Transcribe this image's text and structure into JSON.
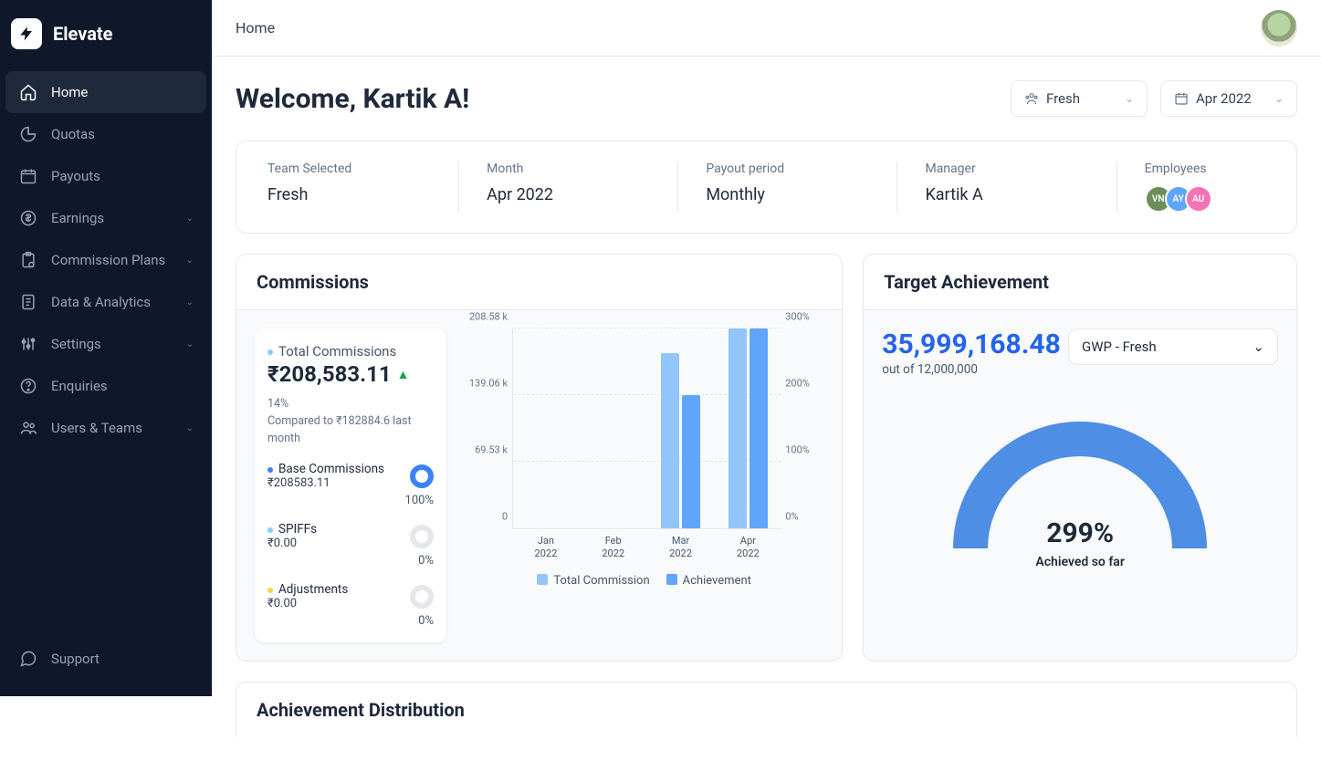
{
  "brand": "Elevate",
  "breadcrumb": "Home",
  "sidebar": {
    "items": [
      {
        "label": "Home",
        "icon": "home",
        "has_submenu": false,
        "active": true
      },
      {
        "label": "Quotas",
        "icon": "pie",
        "has_submenu": false,
        "active": false
      },
      {
        "label": "Payouts",
        "icon": "calendar",
        "has_submenu": false,
        "active": false
      },
      {
        "label": "Earnings",
        "icon": "dollar",
        "has_submenu": true,
        "active": false
      },
      {
        "label": "Commission Plans",
        "icon": "clipboard",
        "has_submenu": true,
        "active": false
      },
      {
        "label": "Data & Analytics",
        "icon": "document",
        "has_submenu": true,
        "active": false
      },
      {
        "label": "Settings",
        "icon": "sliders",
        "has_submenu": true,
        "active": false
      },
      {
        "label": "Enquiries",
        "icon": "help",
        "has_submenu": false,
        "active": false
      },
      {
        "label": "Users & Teams",
        "icon": "users",
        "has_submenu": true,
        "active": false
      }
    ],
    "support_label": "Support"
  },
  "welcome": "Welcome, Kartik A!",
  "selectors": {
    "team_label": "Fresh",
    "month_label": "Apr 2022"
  },
  "summary": {
    "team_label": "Team Selected",
    "team_value": "Fresh",
    "month_label": "Month",
    "month_value": "Apr 2022",
    "period_label": "Payout period",
    "period_value": "Monthly",
    "manager_label": "Manager",
    "manager_value": "Kartik A",
    "employees_label": "Employees",
    "employees": [
      {
        "initials": "VN",
        "color": "#6b8e5a"
      },
      {
        "initials": "AY",
        "color": "#60a5fa"
      },
      {
        "initials": "AU",
        "color": "#f472b6"
      }
    ]
  },
  "commissions": {
    "title": "Commissions",
    "total_label": "Total Commissions",
    "total_value": "₹208,583.11",
    "delta_pct": "14%",
    "delta_caption": "Compared to ₹182884.6 last month",
    "breakdown": [
      {
        "label": "Base Commissions",
        "value": "₹208583.11",
        "pct": "100%",
        "color": "#3b82f6",
        "ring_full": true
      },
      {
        "label": "SPIFFs",
        "value": "₹0.00",
        "pct": "0%",
        "color": "#7dd3fc",
        "ring_full": false
      },
      {
        "label": "Adjustments",
        "value": "₹0.00",
        "pct": "0%",
        "color": "#fcd34d",
        "ring_full": false
      }
    ],
    "legend": {
      "tc": "Total Commission",
      "ach": "Achievement"
    }
  },
  "chart_data": {
    "type": "bar",
    "categories": [
      "Jan 2022",
      "Feb 2022",
      "Mar 2022",
      "Apr 2022"
    ],
    "series": [
      {
        "name": "Total Commission",
        "values": [
          0,
          0,
          182884.6,
          208583.11
        ]
      },
      {
        "name": "Achievement",
        "values": [
          0,
          0,
          200,
          300
        ]
      }
    ],
    "y_left": {
      "ticks": [
        "0",
        "69.53 k",
        "139.06 k",
        "208.58 k"
      ],
      "max": 208580
    },
    "y_right": {
      "ticks": [
        "0%",
        "100%",
        "200%",
        "300%"
      ],
      "max": 300
    }
  },
  "target": {
    "title": "Target Achievement",
    "amount": "35,999,168.48",
    "out_of": "out of 12,000,000",
    "select_value": "GWP - Fresh",
    "gauge_pct": "299%",
    "gauge_label": "Achieved so far"
  },
  "distribution_title": "Achievement Distribution",
  "colors": {
    "accent_blue": "#3b82f6",
    "bar_light": "#93c5fd",
    "bar_dark": "#60a5fa"
  }
}
